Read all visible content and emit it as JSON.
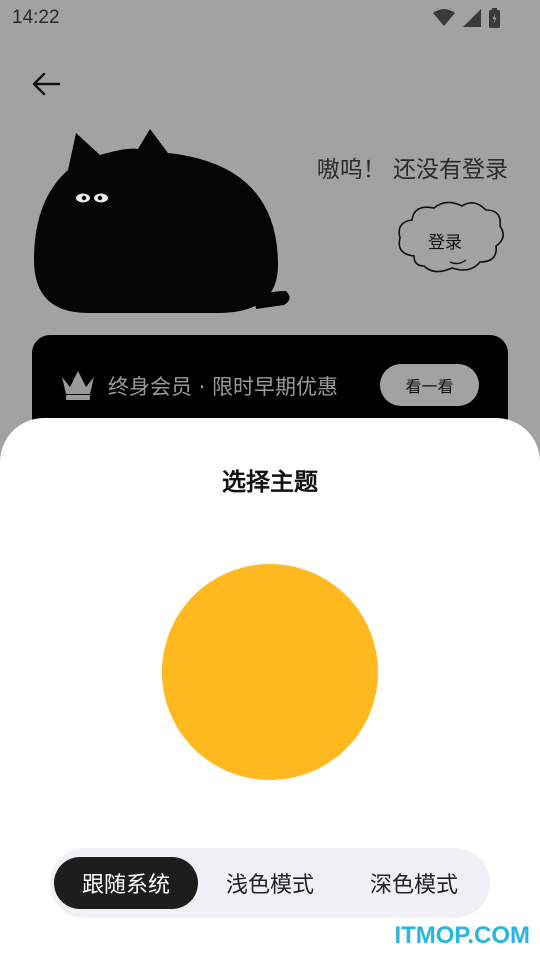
{
  "status_bar": {
    "time": "14:22",
    "icons": [
      "wifi-icon",
      "signal-icon",
      "battery-icon"
    ]
  },
  "header": {
    "back_icon": "arrow-left-icon"
  },
  "profile": {
    "login_prompt": "嗷呜！ 还没有登录",
    "login_button_label": "登录",
    "illustration": "black-cat"
  },
  "vip_banner": {
    "icon": "crown-icon",
    "text": "终身会员 · 限时早期优惠",
    "button_label": "看一看"
  },
  "theme_sheet": {
    "title": "选择主题",
    "preview_color": "#ffb81e",
    "options": [
      {
        "label": "跟随系统",
        "active": true
      },
      {
        "label": "浅色模式",
        "active": false
      },
      {
        "label": "深色模式",
        "active": false
      }
    ]
  },
  "watermark": "ITMOP.COM",
  "colors": {
    "scrim": "#a2a2a2",
    "accent_yellow": "#ffb81e",
    "selected_pill": "#1d1d1d",
    "watermark": "#27b6de"
  }
}
